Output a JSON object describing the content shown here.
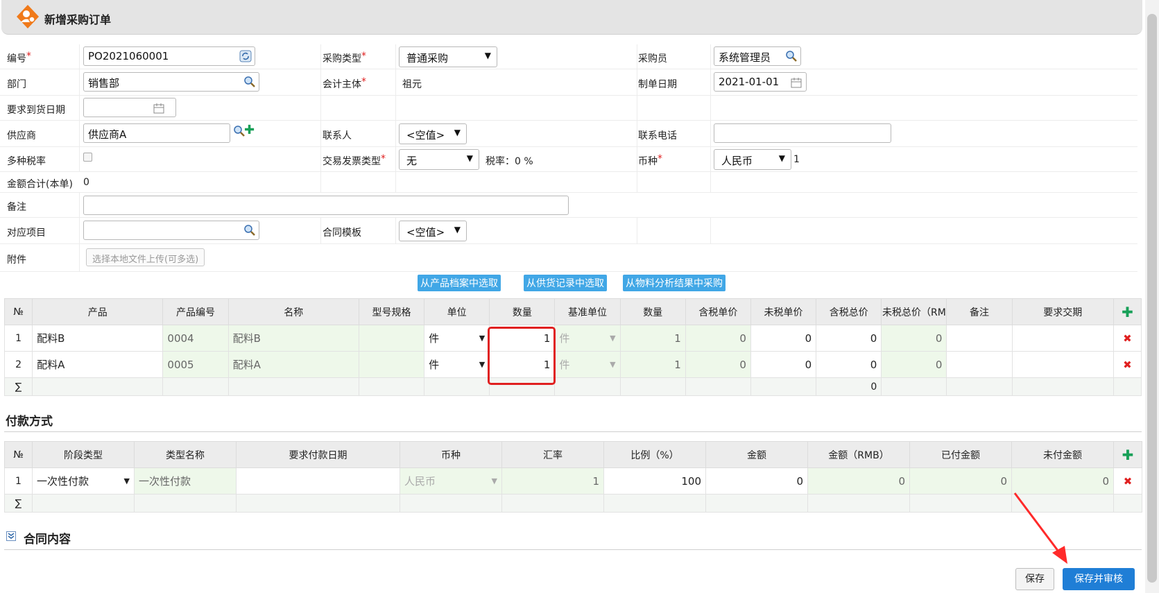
{
  "window": {
    "title": "新增采购订单"
  },
  "form": {
    "number_label": "编号",
    "number_value": "PO2021060001",
    "purchase_type_label": "采购类型",
    "purchase_type_value": "普通采购",
    "buyer_label": "采购员",
    "buyer_value": "系统管理员",
    "dept_label": "部门",
    "dept_value": "销售部",
    "entity_label": "会计主体",
    "entity_value": "祖元",
    "create_date_label": "制单日期",
    "create_date_value": "2021-01-01",
    "delivery_date_label": "要求到货日期",
    "delivery_date_value": "",
    "supplier_label": "供应商",
    "supplier_value": "供应商A",
    "contact_label": "联系人",
    "contact_value": "<空值>",
    "phone_label": "联系电话",
    "phone_value": "",
    "multi_tax_label": "多种税率",
    "invoice_type_label": "交易发票类型",
    "invoice_type_value": "无",
    "tax_rate_text": "税率：0 %",
    "currency_label": "币种",
    "currency_value": "人民币",
    "currency_rate": "1",
    "total_label": "金额合计(本单)",
    "total_value": "0",
    "remark_label": "备注",
    "remark_value": "",
    "project_label": "对应项目",
    "project_value": "",
    "contract_tpl_label": "合同模板",
    "contract_tpl_value": "<空值>",
    "attach_label": "附件",
    "attach_button": "选择本地文件上传(可多选)"
  },
  "actions": {
    "pick_product": "从产品档案中选取",
    "pick_supply": "从供货记录中选取",
    "pick_material": "从物料分析结果中采购"
  },
  "products": {
    "headers": [
      "№",
      "产品",
      "产品编号",
      "名称",
      "型号规格",
      "单位",
      "数量",
      "基准单位",
      "数量",
      "含税单价",
      "未税单价",
      "含税总价",
      "未税总价（RM",
      "备注",
      "要求交期"
    ],
    "rows": [
      {
        "idx": "1",
        "product": "配料B",
        "code": "0004",
        "name": "配料B",
        "spec": "",
        "unit": "件",
        "qty": "1",
        "base_unit": "件",
        "base_qty": "1",
        "price_tax": "0",
        "price_notax": "0",
        "total_tax": "0",
        "total_notax": "0",
        "remark": "",
        "due": ""
      },
      {
        "idx": "2",
        "product": "配料A",
        "code": "0005",
        "name": "配料A",
        "spec": "",
        "unit": "件",
        "qty": "1",
        "base_unit": "件",
        "base_qty": "1",
        "price_tax": "0",
        "price_notax": "0",
        "total_tax": "0",
        "total_notax": "0",
        "remark": "",
        "due": ""
      }
    ],
    "sum_symbol": "∑",
    "sum_total": "0"
  },
  "payment": {
    "title": "付款方式",
    "headers": [
      "№",
      "阶段类型",
      "类型名称",
      "要求付款日期",
      "币种",
      "汇率",
      "比例（%）",
      "金额",
      "金额（RMB）",
      "已付金额",
      "未付金额"
    ],
    "rows": [
      {
        "idx": "1",
        "stage": "一次性付款",
        "type_name": "一次性付款",
        "date": "",
        "currency": "人民币",
        "rate": "1",
        "ratio": "100",
        "amount": "0",
        "amount_rmb": "0",
        "paid": "0",
        "unpaid": "0"
      }
    ],
    "sum_symbol": "∑"
  },
  "contract": {
    "title": "合同内容"
  },
  "footer": {
    "save": "保存",
    "save_audit": "保存并审核"
  },
  "colors": {
    "accent_blue": "#41a7e6",
    "primary": "#1f7ed6",
    "danger": "#e02020",
    "readonly_bg": "#eef8ea"
  }
}
